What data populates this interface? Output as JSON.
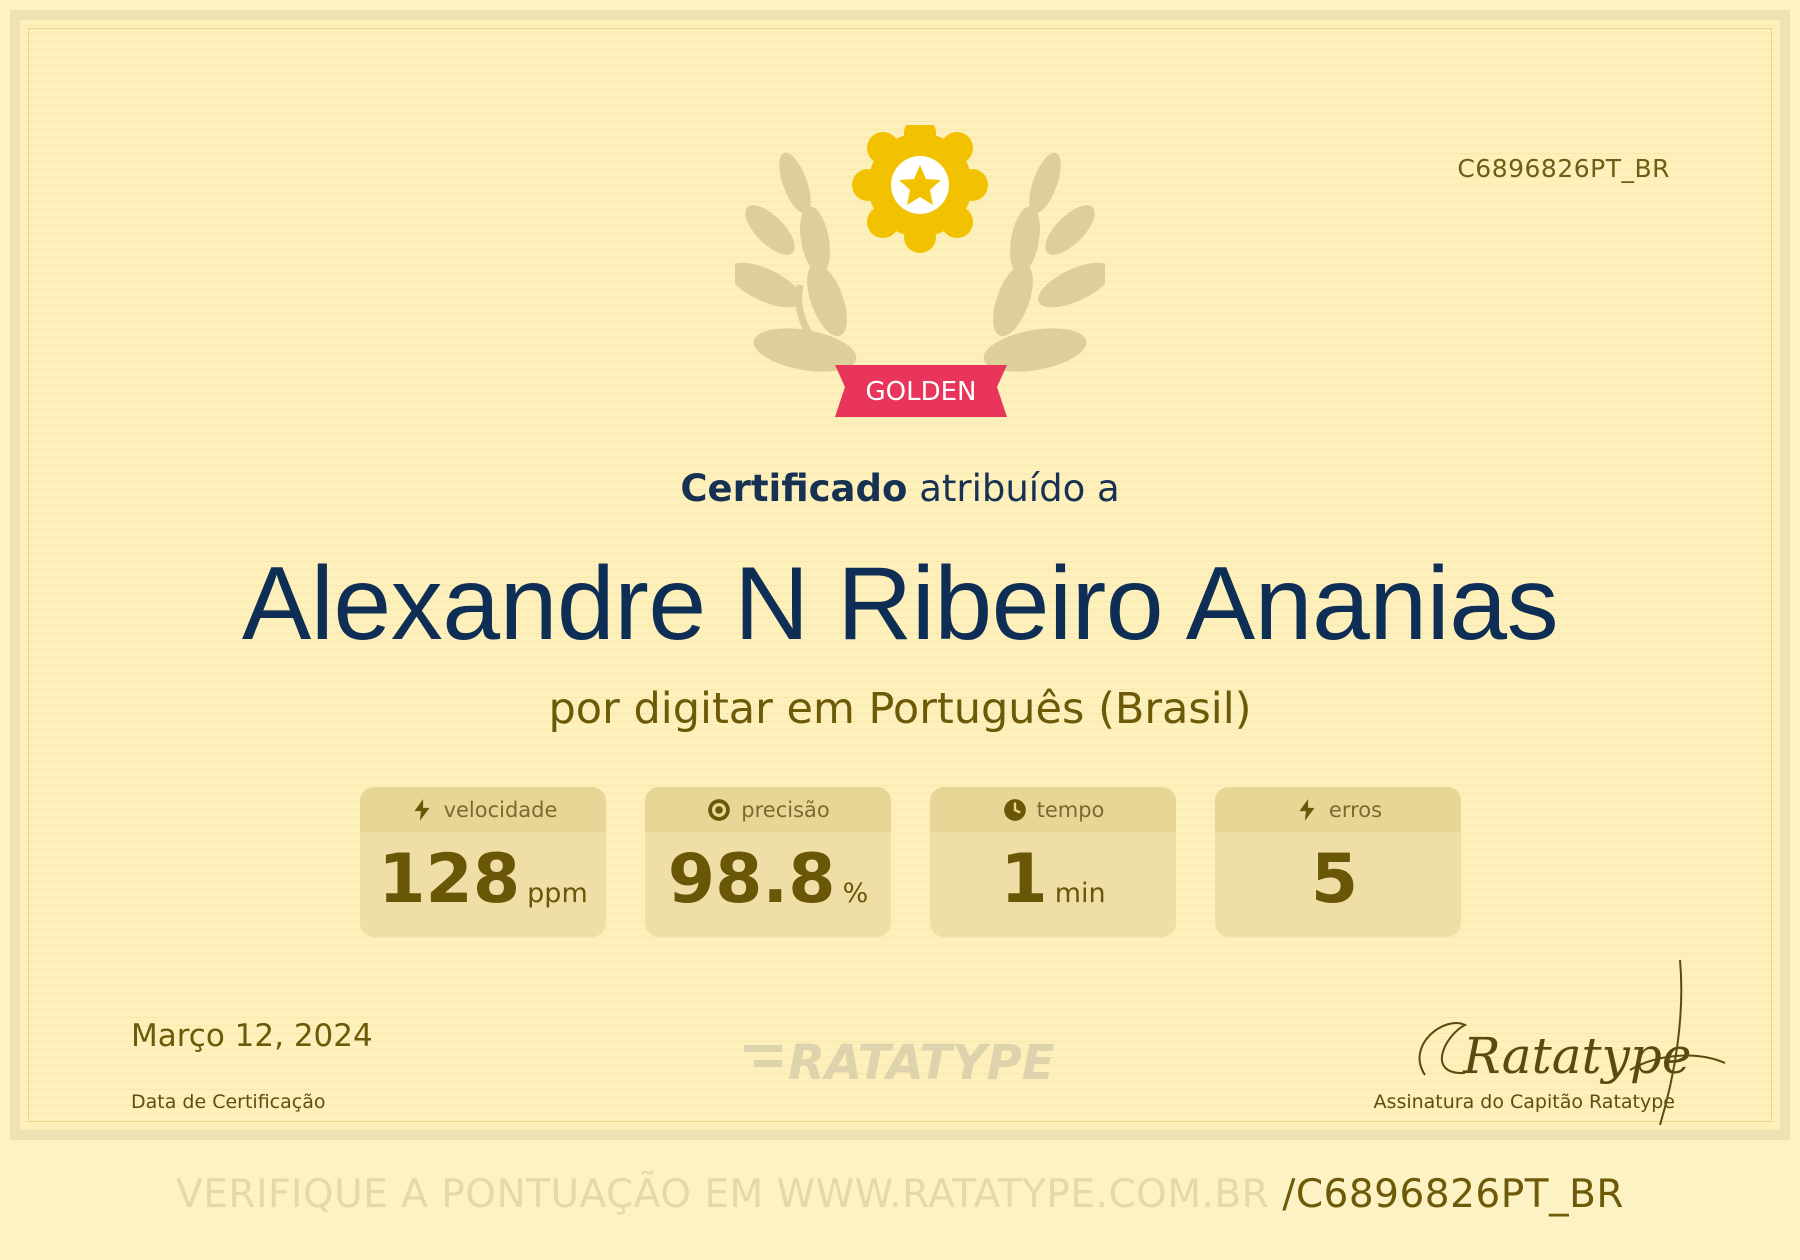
{
  "certificate": {
    "id": "C6896826PT_BR",
    "level": "GOLDEN",
    "heading_bold": "Certificado",
    "heading_rest": "atribuído a",
    "recipient": "Alexandre N Ribeiro Ananias",
    "subtitle": "por digitar em Português (Brasil)"
  },
  "stats": [
    {
      "label": "velocidade",
      "value": "128",
      "unit": "ppm",
      "icon": "lightning-icon"
    },
    {
      "label": "precisão",
      "value": "98.8",
      "unit": "%",
      "icon": "target-icon"
    },
    {
      "label": "tempo",
      "value": "1",
      "unit": "min",
      "icon": "clock-icon"
    },
    {
      "label": "erros",
      "value": "5",
      "unit": "",
      "icon": "lightning-icon"
    }
  ],
  "footer": {
    "date": "Março 12, 2024",
    "date_label": "Data de Certificação",
    "brand": "RATATYPE",
    "signature_label": "Assinatura do Capitão Ratatype",
    "signature_text": "Ratatype"
  },
  "verify": {
    "prefix": "VERIFIQUE A PONTUAÇÃO EM WWW.RATATYPE.COM.BR",
    "code": "/C6896826PT_BR"
  },
  "colors": {
    "background": "#fdf0bb",
    "name": "#0f2e56",
    "gold_text": "#6d5a08",
    "badge_ribbon": "#e9345b",
    "star_badge": "#f2c200"
  }
}
